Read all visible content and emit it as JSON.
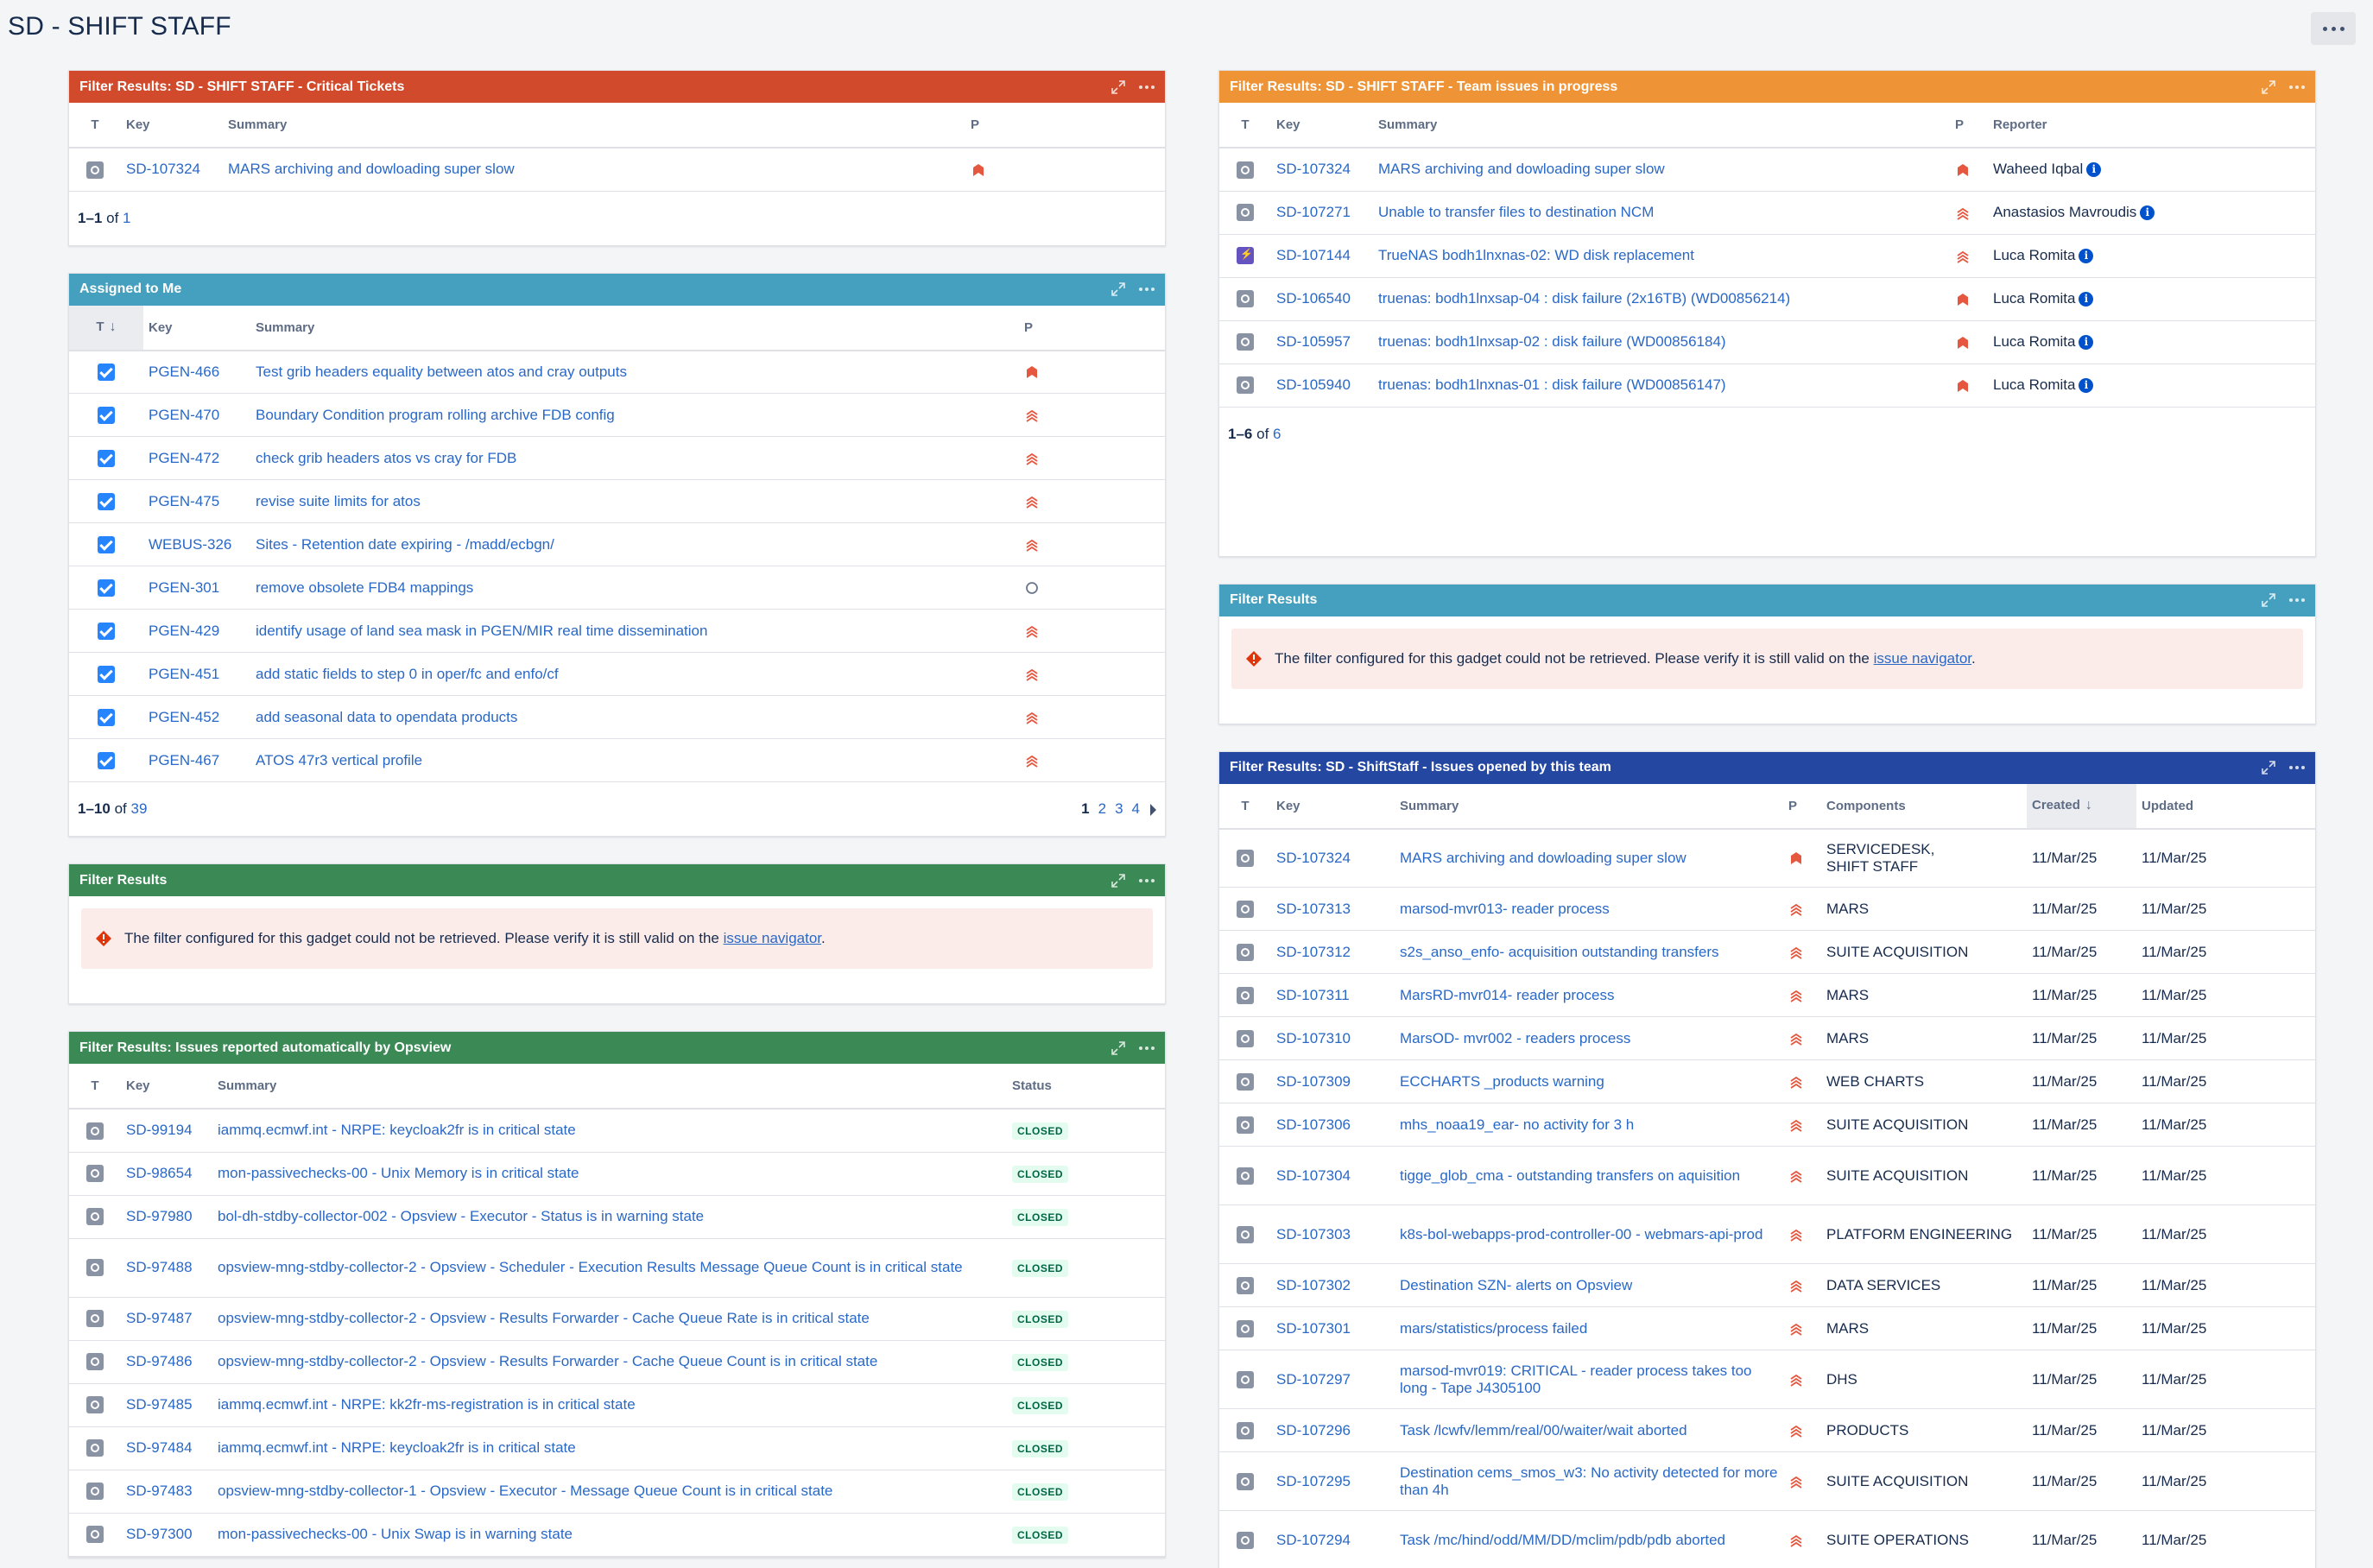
{
  "page": {
    "title": "SD - SHIFT STAFF",
    "more_label": "..."
  },
  "colors": {
    "red": "#d04a2b",
    "teal": "#45a0bf",
    "green": "#3b8a56",
    "orange": "#ee9437",
    "navy": "#2447a2",
    "link": "#2a68c6"
  },
  "critical": {
    "title": "Filter Results: SD - SHIFT STAFF - Critical Tickets",
    "headers": {
      "t": "T",
      "key": "Key",
      "summary": "Summary",
      "p": "P"
    },
    "rows": [
      {
        "key": "SD-107324",
        "summary": "MARS archiving and dowloading super slow",
        "priority": "highest"
      }
    ],
    "footer": {
      "range": "1–1",
      "of": "of",
      "total": "1"
    }
  },
  "assigned": {
    "title": "Assigned to Me",
    "headers": {
      "t": "T",
      "key": "Key",
      "summary": "Summary",
      "p": "P"
    },
    "rows": [
      {
        "key": "PGEN-466",
        "summary": "Test grib headers equality between atos and cray outputs",
        "priority": "highest"
      },
      {
        "key": "PGEN-470",
        "summary": "Boundary Condition program rolling archive FDB config",
        "priority": "high"
      },
      {
        "key": "PGEN-472",
        "summary": "check grib headers atos vs cray for FDB",
        "priority": "high"
      },
      {
        "key": "PGEN-475",
        "summary": "revise suite limits for atos",
        "priority": "high"
      },
      {
        "key": "WEBUS-326",
        "summary": "Sites - Retention date expiring - /madd/ecbgn/",
        "priority": "high"
      },
      {
        "key": "PGEN-301",
        "summary": "remove obsolete FDB4 mappings",
        "priority": "none"
      },
      {
        "key": "PGEN-429",
        "summary": "identify usage of land sea mask in PGEN/MIR real time dissemination",
        "priority": "high"
      },
      {
        "key": "PGEN-451",
        "summary": "add static fields to step 0 in oper/fc and enfo/cf",
        "priority": "high"
      },
      {
        "key": "PGEN-452",
        "summary": "add seasonal data to opendata products",
        "priority": "high"
      },
      {
        "key": "PGEN-467",
        "summary": "ATOS 47r3 vertical profile",
        "priority": "high"
      }
    ],
    "footer": {
      "range": "1–10",
      "of": "of",
      "total": "39"
    },
    "pages": [
      "1",
      "2",
      "3",
      "4"
    ]
  },
  "filter_green": {
    "title": "Filter Results",
    "error": "The filter configured for this gadget could not be retrieved. Please verify it is still valid on the",
    "link": "issue navigator",
    "period": "."
  },
  "opsview": {
    "title": "Filter Results: Issues reported automatically by Opsview",
    "headers": {
      "t": "T",
      "key": "Key",
      "summary": "Summary",
      "status": "Status"
    },
    "rows": [
      {
        "key": "SD-99194",
        "summary": "iammq.ecmwf.int - NRPE: keycloak2fr is in critical state",
        "status": "CLOSED"
      },
      {
        "key": "SD-98654",
        "summary": "mon-passivechecks-00 - Unix Memory is in critical state",
        "status": "CLOSED"
      },
      {
        "key": "SD-97980",
        "summary": "bol-dh-stdby-collector-002 - Opsview - Executor - Status is in warning state",
        "status": "CLOSED"
      },
      {
        "key": "SD-97488",
        "summary": "opsview-mng-stdby-collector-2 - Opsview - Scheduler - Execution Results Message Queue Count is in critical state",
        "status": "CLOSED"
      },
      {
        "key": "SD-97487",
        "summary": "opsview-mng-stdby-collector-2 - Opsview - Results Forwarder - Cache Queue Rate is in critical state",
        "status": "CLOSED"
      },
      {
        "key": "SD-97486",
        "summary": "opsview-mng-stdby-collector-2 - Opsview - Results Forwarder - Cache Queue Count is in critical state",
        "status": "CLOSED"
      },
      {
        "key": "SD-97485",
        "summary": "iammq.ecmwf.int - NRPE: kk2fr-ms-registration is in critical state",
        "status": "CLOSED"
      },
      {
        "key": "SD-97484",
        "summary": "iammq.ecmwf.int - NRPE: keycloak2fr is in critical state",
        "status": "CLOSED"
      },
      {
        "key": "SD-97483",
        "summary": "opsview-mng-stdby-collector-1 - Opsview - Executor - Message Queue Count is in critical state",
        "status": "CLOSED"
      },
      {
        "key": "SD-97300",
        "summary": "mon-passivechecks-00 - Unix Swap is in warning state",
        "status": "CLOSED"
      }
    ]
  },
  "team": {
    "title": "Filter Results: SD - SHIFT STAFF - Team issues in progress",
    "headers": {
      "t": "T",
      "key": "Key",
      "summary": "Summary",
      "p": "P",
      "reporter": "Reporter"
    },
    "rows": [
      {
        "key": "SD-107324",
        "summary": "MARS archiving and dowloading super slow",
        "priority": "highest",
        "reporter": "Waheed Iqbal",
        "type": "service"
      },
      {
        "key": "SD-107271",
        "summary": "Unable to transfer files to destination NCM",
        "priority": "high",
        "reporter": "Anastasios Mavroudis",
        "type": "service"
      },
      {
        "key": "SD-107144",
        "summary": "TrueNAS bodh1lnxnas-02: WD disk replacement",
        "priority": "high",
        "reporter": "Luca Romita",
        "type": "change"
      },
      {
        "key": "SD-106540",
        "summary": "truenas: bodh1lnxsap-04 : disk failure (2x16TB) (WD00856214)",
        "priority": "highest",
        "reporter": "Luca Romita",
        "type": "service"
      },
      {
        "key": "SD-105957",
        "summary": "truenas: bodh1lnxsap-02 : disk failure (WD00856184)",
        "priority": "highest",
        "reporter": "Luca Romita",
        "type": "service"
      },
      {
        "key": "SD-105940",
        "summary": "truenas: bodh1lnxnas-01 : disk failure (WD00856147)",
        "priority": "highest",
        "reporter": "Luca Romita",
        "type": "service"
      }
    ],
    "footer": {
      "range": "1–6",
      "of": "of",
      "total": "6"
    }
  },
  "filter_teal": {
    "title": "Filter Results",
    "error": "The filter configured for this gadget could not be retrieved. Please verify it is still valid on the",
    "link": "issue navigator",
    "period": "."
  },
  "opened": {
    "title": "Filter Results: SD - ShiftStaff - Issues opened by this team",
    "headers": {
      "t": "T",
      "key": "Key",
      "summary": "Summary",
      "p": "P",
      "components": "Components",
      "created": "Created",
      "updated": "Updated"
    },
    "rows": [
      {
        "key": "SD-107324",
        "summary": "MARS archiving and dowloading super slow",
        "priority": "highest",
        "components": "SERVICEDESK,",
        "components2": "SHIFT STAFF",
        "created": "11/Mar/25",
        "updated": "11/Mar/25"
      },
      {
        "key": "SD-107313",
        "summary": "marsod-mvr013- reader process",
        "priority": "high",
        "components": "MARS",
        "created": "11/Mar/25",
        "updated": "11/Mar/25"
      },
      {
        "key": "SD-107312",
        "summary": "s2s_anso_enfo- acquisition outstanding transfers",
        "priority": "high",
        "components": "SUITE ACQUISITION",
        "created": "11/Mar/25",
        "updated": "11/Mar/25"
      },
      {
        "key": "SD-107311",
        "summary": "MarsRD-mvr014- reader process",
        "priority": "high",
        "components": "MARS",
        "created": "11/Mar/25",
        "updated": "11/Mar/25"
      },
      {
        "key": "SD-107310",
        "summary": "MarsOD- mvr002 - readers process",
        "priority": "high",
        "components": "MARS",
        "created": "11/Mar/25",
        "updated": "11/Mar/25"
      },
      {
        "key": "SD-107309",
        "summary": "ECCHARTS _products warning",
        "priority": "high",
        "components": "WEB CHARTS",
        "created": "11/Mar/25",
        "updated": "11/Mar/25"
      },
      {
        "key": "SD-107306",
        "summary": "mhs_noaa19_ear- no activity for 3 h",
        "priority": "high",
        "components": "SUITE ACQUISITION",
        "created": "11/Mar/25",
        "updated": "11/Mar/25"
      },
      {
        "key": "SD-107304",
        "summary": "tigge_glob_cma - outstanding transfers on aquisition",
        "priority": "high",
        "components": "SUITE ACQUISITION",
        "created": "11/Mar/25",
        "updated": "11/Mar/25"
      },
      {
        "key": "SD-107303",
        "summary": "k8s-bol-webapps-prod-controller-00 - webmars-api-prod",
        "priority": "high",
        "components": "PLATFORM ENGINEERING",
        "created": "11/Mar/25",
        "updated": "11/Mar/25"
      },
      {
        "key": "SD-107302",
        "summary": "Destination SZN- alerts on Opsview",
        "priority": "high",
        "components": "DATA SERVICES",
        "created": "11/Mar/25",
        "updated": "11/Mar/25"
      },
      {
        "key": "SD-107301",
        "summary": "mars/statistics/process failed",
        "priority": "high",
        "components": "MARS",
        "created": "11/Mar/25",
        "updated": "11/Mar/25"
      },
      {
        "key": "SD-107297",
        "summary": "marsod-mvr019: CRITICAL - reader process takes too long - Tape J4305100",
        "priority": "high",
        "components": "DHS",
        "created": "11/Mar/25",
        "updated": "11/Mar/25"
      },
      {
        "key": "SD-107296",
        "summary": "Task /lcwfv/lemm/real/00/waiter/wait aborted",
        "priority": "high",
        "components": "PRODUCTS",
        "created": "11/Mar/25",
        "updated": "11/Mar/25"
      },
      {
        "key": "SD-107295",
        "summary": "Destination cems_smos_w3: No activity detected for more than 4h",
        "priority": "high",
        "components": "SUITE ACQUISITION",
        "created": "11/Mar/25",
        "updated": "11/Mar/25"
      },
      {
        "key": "SD-107294",
        "summary": "Task /mc/hind/odd/MM/DD/mclim/pdb/pdb aborted",
        "priority": "high",
        "components": "SUITE OPERATIONS",
        "created": "11/Mar/25",
        "updated": "11/Mar/25"
      }
    ]
  }
}
